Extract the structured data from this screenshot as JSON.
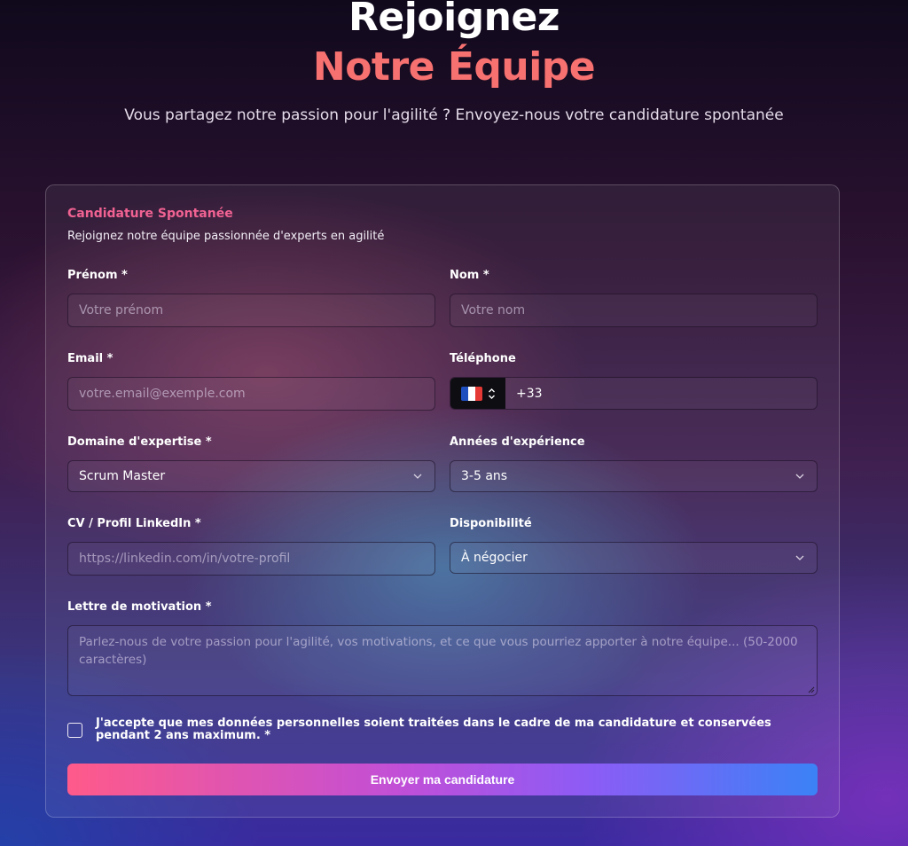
{
  "hero": {
    "title_line1": "Rejoignez",
    "title_line2": "Notre Équipe",
    "subtitle": "Vous partagez notre passion pour l'agilité ? Envoyez-nous votre candidature spontanée"
  },
  "form": {
    "title": "Candidature Spontanée",
    "description": "Rejoignez notre équipe passionnée d'experts en agilité",
    "first_name": {
      "label": "Prénom *",
      "placeholder": "Votre prénom"
    },
    "last_name": {
      "label": "Nom *",
      "placeholder": "Votre nom"
    },
    "email": {
      "label": "Email *",
      "placeholder": "votre.email@exemple.com"
    },
    "phone": {
      "label": "Téléphone",
      "value": "+33",
      "country_flag": "fr-flag-icon"
    },
    "expertise": {
      "label": "Domaine d'expertise *",
      "value": "Scrum Master"
    },
    "experience": {
      "label": "Années d'expérience",
      "value": "3-5 ans"
    },
    "cv": {
      "label": "CV / Profil LinkedIn *",
      "placeholder": "https://linkedin.com/in/votre-profil"
    },
    "availability": {
      "label": "Disponibilité",
      "value": "À négocier"
    },
    "motivation": {
      "label": "Lettre de motivation *",
      "placeholder": "Parlez-nous de votre passion pour l'agilité, vos motivations, et ce que vous pourriez apporter à notre équipe... (50-2000 caractères)"
    },
    "consent": "J'accepte que mes données personnelles soient traitées dans le cadre de ma candidature et conservées pendant 2 ans maximum. *",
    "submit": "Envoyer ma candidature"
  },
  "colors": {
    "accent_title": "#f87171",
    "accent_card_title": "#f06292",
    "button_gradient": [
      "#ff5a8a",
      "#8b5cf6",
      "#3b82f6"
    ]
  }
}
